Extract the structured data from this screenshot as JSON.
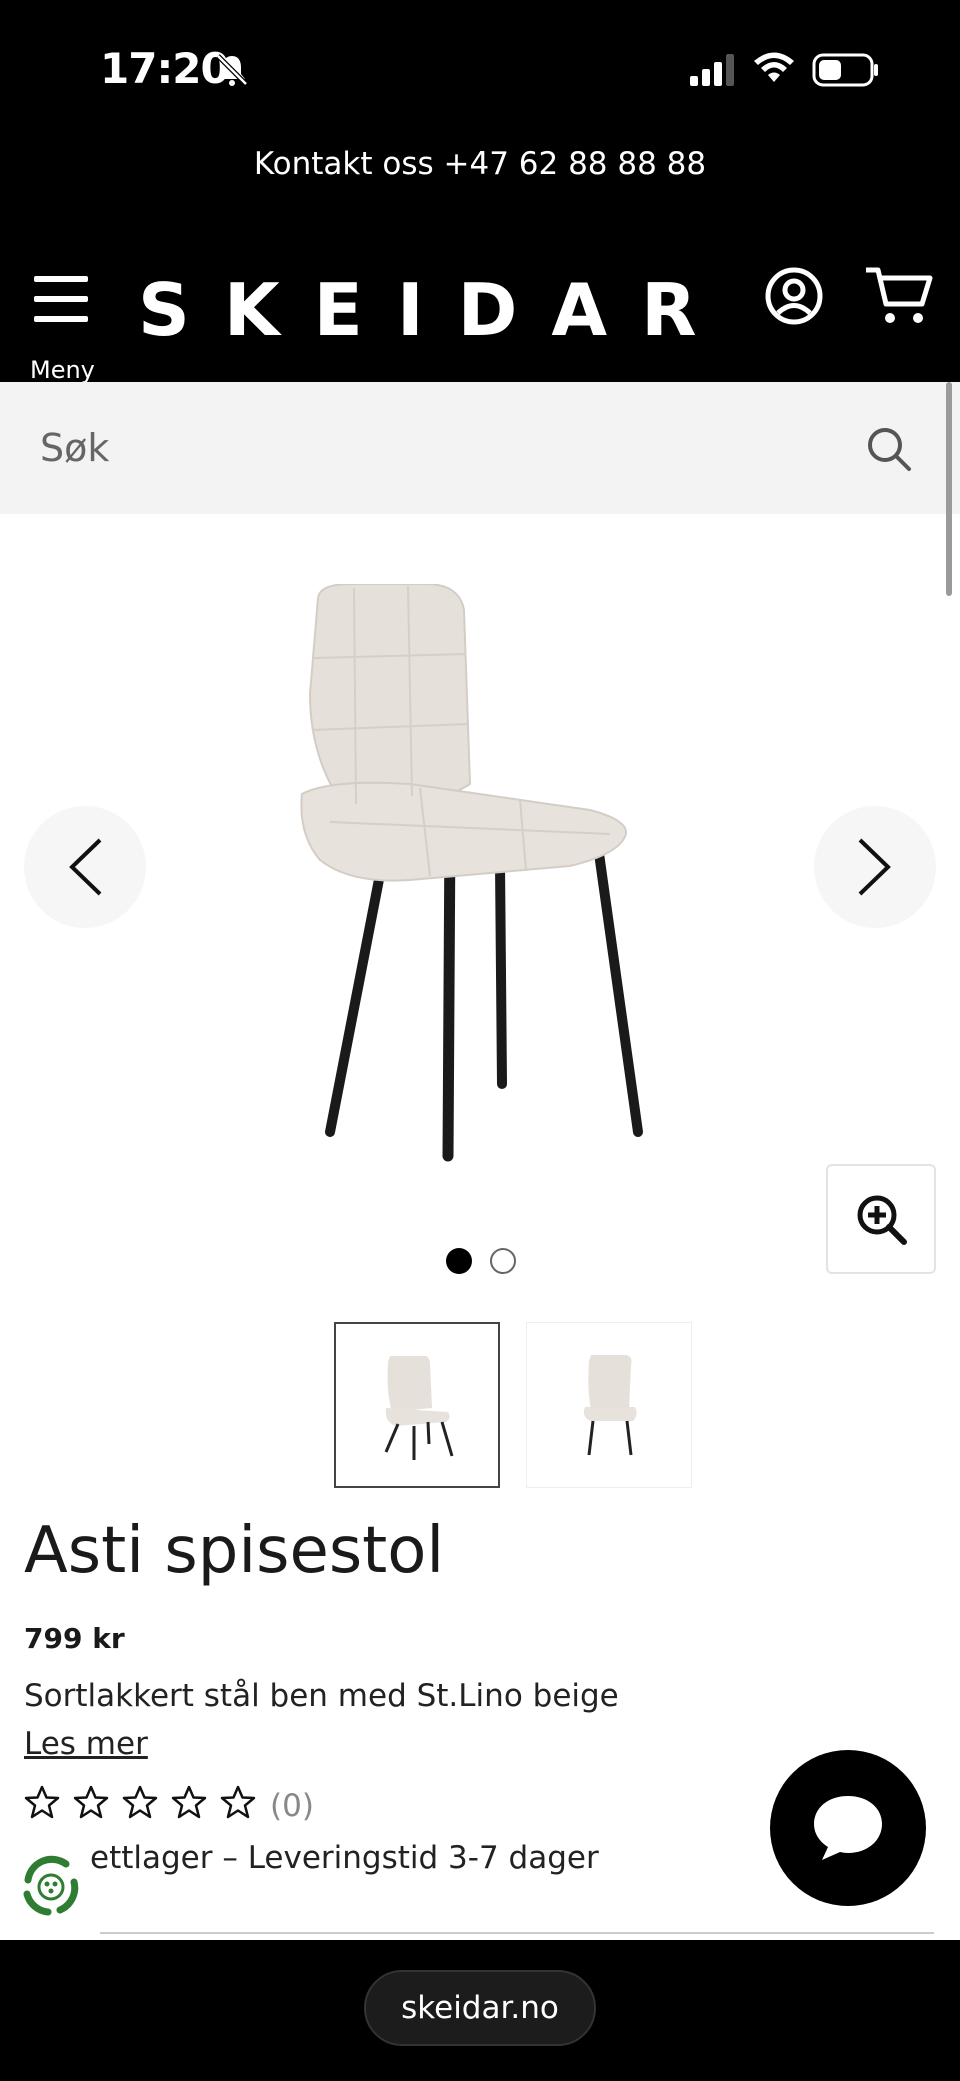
{
  "status_bar": {
    "time": "17:20",
    "icons": [
      "bell-slash-icon",
      "cellular-signal-icon",
      "wifi-icon",
      "battery-icon"
    ]
  },
  "contact_banner": {
    "text": "Kontakt oss +47 62 88 88 88"
  },
  "header": {
    "menu_label": "Meny",
    "logo_text": "SKEIDAR",
    "icons": [
      "hamburger-menu-icon",
      "account-icon",
      "cart-icon"
    ]
  },
  "search": {
    "placeholder": "Søk"
  },
  "gallery": {
    "image_count": 2,
    "active_index": 0,
    "icons": [
      "chevron-left-icon",
      "chevron-right-icon",
      "zoom-in-icon"
    ]
  },
  "product": {
    "title": "Asti spisestol",
    "price": "799 kr",
    "description": "Sortlakkert stål ben med St.Lino beige",
    "read_more": "Les mer",
    "rating": 0,
    "rating_max": 5,
    "review_count": "(0)",
    "stock_text": "ettlager – Leveringstid 3-7 dager"
  },
  "floating": {
    "icons": [
      "eco-recycle-icon",
      "chat-icon"
    ]
  },
  "browser": {
    "url": "skeidar.no"
  },
  "colors": {
    "header_bg": "#000000",
    "search_bg": "#f3f3f3",
    "chair_fabric": "#e8e2dc",
    "chair_legs": "#1a1a1a",
    "eco_green": "#2e7d32"
  }
}
